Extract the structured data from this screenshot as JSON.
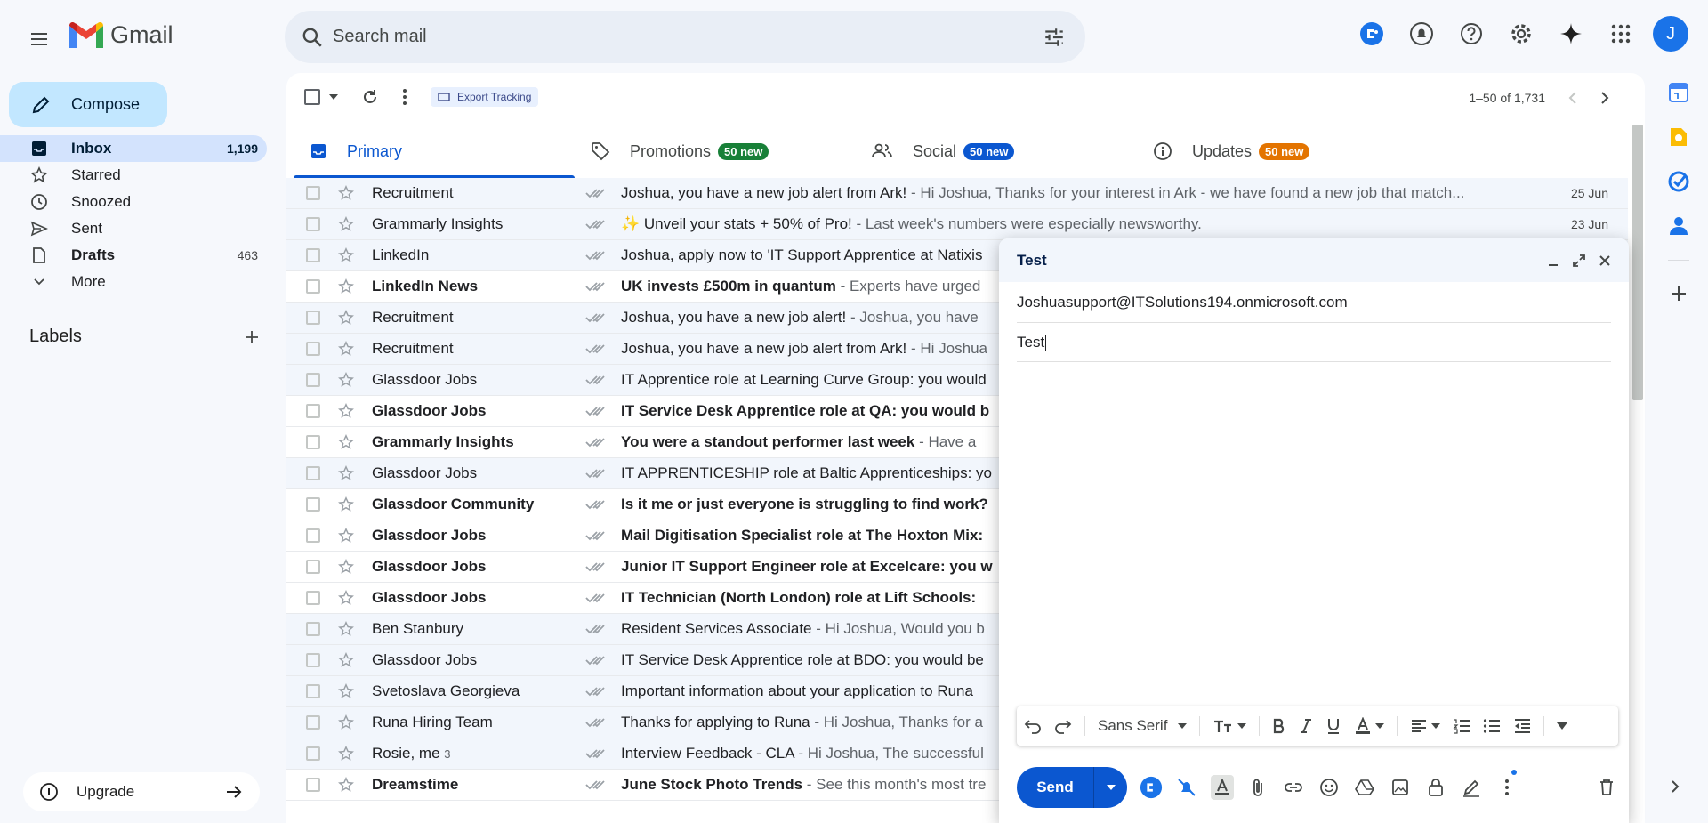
{
  "app": {
    "name": "Gmail"
  },
  "search": {
    "placeholder": "Search mail"
  },
  "sidebar": {
    "compose_label": "Compose",
    "items": [
      {
        "label": "Inbox",
        "count": "1,199"
      },
      {
        "label": "Starred",
        "count": ""
      },
      {
        "label": "Snoozed",
        "count": ""
      },
      {
        "label": "Sent",
        "count": ""
      },
      {
        "label": "Drafts",
        "count": "463"
      },
      {
        "label": "More",
        "count": ""
      }
    ],
    "labels_title": "Labels",
    "upgrade_label": "Upgrade"
  },
  "toolbar": {
    "export_label": "Export Tracking",
    "pagination": "1–50 of 1,731"
  },
  "tabs": [
    {
      "label": "Primary",
      "badge": ""
    },
    {
      "label": "Promotions",
      "badge": "50 new"
    },
    {
      "label": "Social",
      "badge": "50 new"
    },
    {
      "label": "Updates",
      "badge": "50 new"
    }
  ],
  "emails": [
    {
      "sender": "Recruitment",
      "count": "",
      "subject": "Joshua, you have a new job alert from Ark!",
      "preview": " - Hi Joshua, Thanks for your interest in Ark - we have found a new job that match...",
      "date": "25 Jun"
    },
    {
      "sender": "Grammarly Insights",
      "count": "",
      "subject": "✨ Unveil your stats + 50% of Pro!",
      "preview": " - Last week's numbers were especially newsworthy.",
      "date": "23 Jun"
    },
    {
      "sender": "LinkedIn",
      "count": "",
      "subject": "Joshua, apply now to 'IT Support Apprentice at Natixis",
      "preview": "",
      "date": ""
    },
    {
      "sender": "LinkedIn News",
      "count": "",
      "subject": "UK invests £500m in quantum",
      "preview": " - Experts have urged",
      "date": ""
    },
    {
      "sender": "Recruitment",
      "count": "",
      "subject": "Joshua, you have a new job alert!",
      "preview": " - Joshua, you have",
      "date": ""
    },
    {
      "sender": "Recruitment",
      "count": "",
      "subject": "Joshua, you have a new job alert from Ark!",
      "preview": " - Hi Joshua",
      "date": ""
    },
    {
      "sender": "Glassdoor Jobs",
      "count": "",
      "subject": "IT Apprentice role at Learning Curve Group: you would",
      "preview": "",
      "date": ""
    },
    {
      "sender": "Glassdoor Jobs",
      "count": "",
      "subject": "IT Service Desk Apprentice role at QA: you would b",
      "preview": "",
      "date": ""
    },
    {
      "sender": "Grammarly Insights",
      "count": "",
      "subject": "You were a standout performer last week",
      "preview": " - Have a",
      "date": ""
    },
    {
      "sender": "Glassdoor Jobs",
      "count": "",
      "subject": "IT APPRENTICESHIP role at Baltic Apprenticeships: yo",
      "preview": "",
      "date": ""
    },
    {
      "sender": "Glassdoor Community",
      "count": "",
      "subject": "Is it me or just everyone is struggling to find work?",
      "preview": "",
      "date": ""
    },
    {
      "sender": "Glassdoor Jobs",
      "count": "",
      "subject": "Mail Digitisation Specialist role at The Hoxton Mix:",
      "preview": "",
      "date": ""
    },
    {
      "sender": "Glassdoor Jobs",
      "count": "",
      "subject": "Junior IT Support Engineer role at Excelcare: you w",
      "preview": "",
      "date": ""
    },
    {
      "sender": "Glassdoor Jobs",
      "count": "",
      "subject": "IT Technician (North London) role at Lift Schools:",
      "preview": "",
      "date": ""
    },
    {
      "sender": "Ben Stanbury",
      "count": "",
      "subject": "Resident Services Associate",
      "preview": " - Hi Joshua, Would you b",
      "date": ""
    },
    {
      "sender": "Glassdoor Jobs",
      "count": "",
      "subject": "IT Service Desk Apprentice role at BDO: you would be",
      "preview": "",
      "date": ""
    },
    {
      "sender": "Svetoslava Georgieva",
      "count": "",
      "subject": "Important information about your application to Runa",
      "preview": "",
      "date": ""
    },
    {
      "sender": "Runa Hiring Team",
      "count": "",
      "subject": "Thanks for applying to Runa",
      "preview": " - Hi Joshua, Thanks for a",
      "date": ""
    },
    {
      "sender": "Rosie, me",
      "count": "3",
      "subject": "Interview Feedback - CLA",
      "preview": " - Hi Joshua, The successful",
      "date": ""
    },
    {
      "sender": "Dreamstime",
      "count": "",
      "subject": "June Stock Photo Trends",
      "preview": " - See this month's most tre",
      "date": ""
    }
  ],
  "compose_window": {
    "title": "Test",
    "to": "Joshuasupport@ITSolutions194.onmicrosoft.com",
    "subject": "Test",
    "font": "Sans Serif",
    "send_label": "Send"
  },
  "user": {
    "initial": "J"
  },
  "colors": {
    "accent": "#0b57d0",
    "promotions_badge": "#188038",
    "social_badge": "#0b57d0",
    "updates_badge": "#e37400"
  }
}
